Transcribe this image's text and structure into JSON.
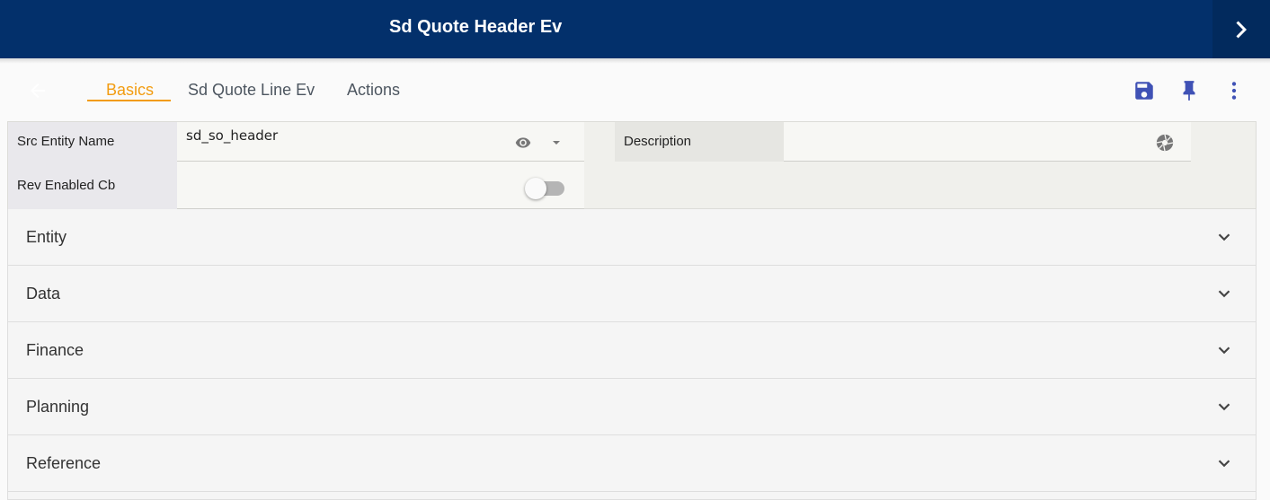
{
  "header": {
    "title": "Sd Quote Header Ev",
    "next_icon": "chevron-right-icon",
    "background": "#03306b"
  },
  "toolbar": {
    "back_icon": "arrow-left-icon",
    "tabs": [
      {
        "label": "Basics",
        "active": true
      },
      {
        "label": "Sd Quote Line Ev",
        "active": false
      },
      {
        "label": "Actions",
        "active": false
      }
    ],
    "actions": [
      {
        "icon": "save-icon"
      },
      {
        "icon": "pin-icon"
      },
      {
        "icon": "more-vertical-icon"
      }
    ],
    "accent": "#f29c11",
    "icon_color": "#3f51b5"
  },
  "form": {
    "src_entity_name": {
      "label": "Src Entity Name",
      "value": "sd_so_header",
      "icons": [
        "eye-icon",
        "dropdown-arrow-icon"
      ]
    },
    "description": {
      "label": "Description",
      "value": "",
      "icon": "aperture-icon"
    },
    "rev_enabled_cb": {
      "label": "Rev Enabled Cb",
      "checked": false
    }
  },
  "sections": [
    {
      "label": "Entity"
    },
    {
      "label": "Data"
    },
    {
      "label": "Finance"
    },
    {
      "label": "Planning"
    },
    {
      "label": "Reference"
    }
  ]
}
